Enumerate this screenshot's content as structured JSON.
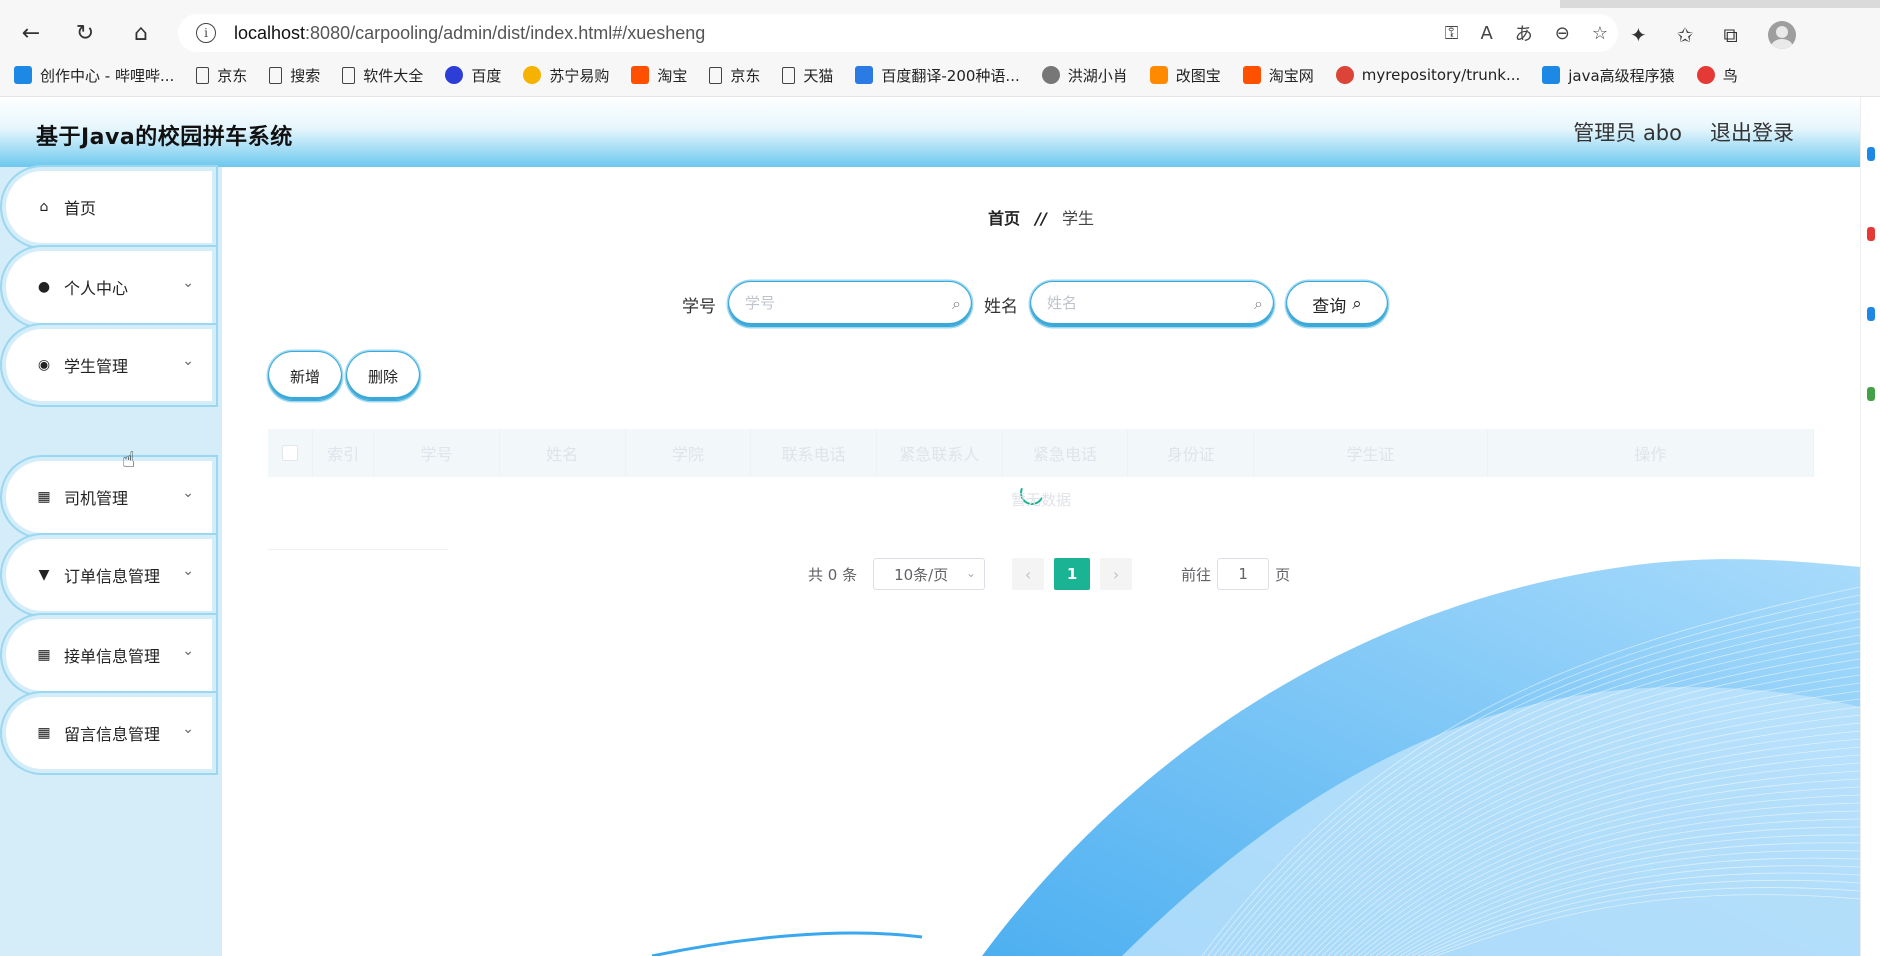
{
  "browser": {
    "url_host": "localhost",
    "url_rest": ":8080/carpooling/admin/dist/index.html#/xuesheng",
    "bookmarks": [
      {
        "label": "创作中心 - 哔哩哔...",
        "icon": "bilibili-icon",
        "cls": "tv"
      },
      {
        "label": "京东",
        "icon": "page-icon",
        "cls": "page"
      },
      {
        "label": "搜索",
        "icon": "page-icon",
        "cls": "page"
      },
      {
        "label": "软件大全",
        "icon": "page-icon",
        "cls": "page"
      },
      {
        "label": "百度",
        "icon": "baidu-icon",
        "cls": "baidu"
      },
      {
        "label": "苏宁易购",
        "icon": "suning-icon",
        "cls": "suning"
      },
      {
        "label": "淘宝",
        "icon": "taobao-icon",
        "cls": "taobao"
      },
      {
        "label": "京东",
        "icon": "page-icon",
        "cls": "page"
      },
      {
        "label": "天猫",
        "icon": "page-icon",
        "cls": "page"
      },
      {
        "label": "百度翻译-200种语...",
        "icon": "fanyi-icon",
        "cls": "fanyi"
      },
      {
        "label": "洪湖小肖",
        "icon": "hong-icon",
        "cls": "hong"
      },
      {
        "label": "改图宝",
        "icon": "gaitubao-icon",
        "cls": "gai"
      },
      {
        "label": "淘宝网",
        "icon": "taobao-icon",
        "cls": "taobao"
      },
      {
        "label": "myrepository/trunk...",
        "icon": "chrome-icon",
        "cls": "chrome"
      },
      {
        "label": "java高级程序猿",
        "icon": "bilibili-icon",
        "cls": "tv"
      },
      {
        "label": "鸟",
        "icon": "bird-icon",
        "cls": "bird"
      }
    ]
  },
  "header": {
    "title": "基于Java的校园拼车系统",
    "user": "管理员 abo",
    "logout": "退出登录"
  },
  "sidebar": {
    "items": [
      {
        "label": "首页",
        "icon": "⌂",
        "chevron": false
      },
      {
        "label": "个人中心",
        "icon": "●",
        "chevron": true
      },
      {
        "label": "学生管理",
        "icon": "◉",
        "chevron": true
      },
      {
        "label": "司机管理",
        "icon": "▦",
        "chevron": true
      },
      {
        "label": "订单信息管理",
        "icon": "▼",
        "chevron": true
      },
      {
        "label": "接单信息管理",
        "icon": "▦",
        "chevron": true
      },
      {
        "label": "留言信息管理",
        "icon": "▦",
        "chevron": true
      }
    ],
    "active_sub": "学生"
  },
  "breadcrumb": {
    "home": "首页",
    "sep": "//",
    "current": "学生"
  },
  "search": {
    "xuehao_label": "学号",
    "xuehao_placeholder": "学号",
    "xingming_label": "姓名",
    "xingming_placeholder": "姓名",
    "query_label": "查询"
  },
  "actions": {
    "add": "新增",
    "delete": "删除"
  },
  "table": {
    "columns": [
      "索引",
      "学号",
      "姓名",
      "学院",
      "联系电话",
      "紧急联系人",
      "紧急电话",
      "身份证",
      "学生证",
      "操作"
    ],
    "empty_text": "暂无数据"
  },
  "pagination": {
    "total": "共 0 条",
    "page_size": "10条/页",
    "current_page": "1",
    "goto_label": "前往",
    "goto_value": "1",
    "page_unit": "页"
  },
  "colors": {
    "accent": "#3ba8e0",
    "pager_active": "#1ab394",
    "sidebar_bg": "#d4edf8"
  }
}
